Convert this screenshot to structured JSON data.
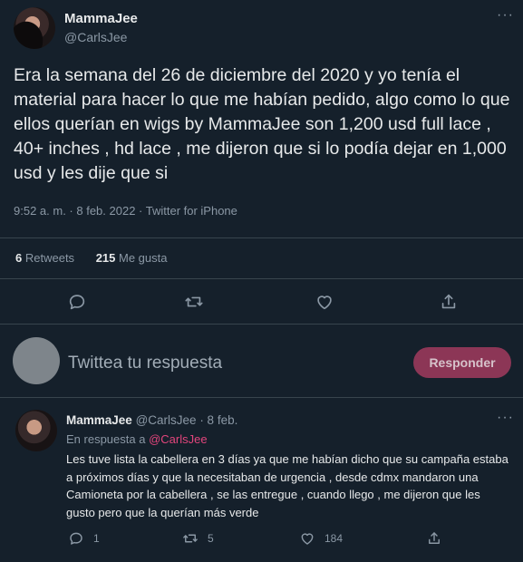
{
  "main_tweet": {
    "author_name": "MammaJee",
    "author_handle": "@CarlsJee",
    "more": "···",
    "text": "Era la semana del 26 de diciembre del 2020 y yo tenía el material para hacer lo que me habían pedido, algo como lo que ellos querían en wigs by MammaJee son 1,200 usd full lace , 40+ inches , hd lace , me dijeron que si lo podía dejar en 1,000 usd y les dije que si",
    "meta": "9:52 a. m. · 8 feb. 2022 · Twitter for iPhone",
    "retweets_count": "6",
    "retweets_label": "Retweets",
    "likes_count": "215",
    "likes_label": "Me gusta"
  },
  "composer": {
    "placeholder": "Twittea tu respuesta",
    "button_label": "Responder"
  },
  "reply_tweet": {
    "author_name": "MammaJee",
    "author_handle": "@CarlsJee",
    "date": "· 8 feb.",
    "more": "···",
    "context_prefix": "En respuesta a",
    "context_mention": "@CarlsJee",
    "text": "Les tuve lista la cabellera en 3 días ya que me habían dicho que su campaña estaba a próximos días y que la necesitaban de urgencia , desde cdmx mandaron una Camioneta por la cabellera , se las entregue , cuando llego , me dijeron que les gusto pero que la querían más verde",
    "reply_count": "1",
    "retweet_count": "5",
    "like_count": "184"
  },
  "colors": {
    "background": "#15202b",
    "text": "#e7e9ea",
    "muted": "#8b98a5",
    "accent": "#e2457c",
    "button": "#8c3656"
  }
}
